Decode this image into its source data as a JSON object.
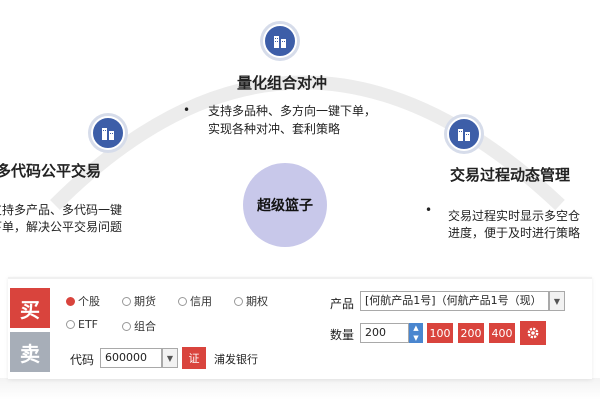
{
  "features": {
    "top": {
      "title": "量化组合对冲",
      "desc_line1": "支持多品种、多方向一键下单，",
      "desc_line2": "实现各种对冲、套利策略"
    },
    "left": {
      "title": "多代码公平交易",
      "desc_line1": "支持多产品、多代码一键",
      "desc_line2": "下单，解决公平交易问题"
    },
    "right": {
      "title": "交易过程动态管理",
      "desc_line1": "交易过程实时显示多空仓",
      "desc_line2": "进度，便于及时进行策略"
    },
    "center": "超级篮子",
    "bullet": "•",
    "icon": "building-icon"
  },
  "trade_panel": {
    "buy_label": "买",
    "sell_label": "卖",
    "types": [
      "个股",
      "期货",
      "信用",
      "期权",
      "ETF",
      "组合"
    ],
    "selected_type": "个股",
    "code_label": "代码",
    "code_value": "600000",
    "exchange_badge": "证",
    "stock_name": "浦发银行",
    "product_label": "产品",
    "product_value": "[何航产品1号]（何航产品1号（现）",
    "quantity_label": "数量",
    "quantity_value": "200",
    "quick_qty": [
      "100",
      "200",
      "400"
    ],
    "settings_icon": "gear-icon",
    "colors": {
      "accent": "#d9443d",
      "icon_blue": "#3d5ea8",
      "center": "#c8c8ea"
    }
  }
}
